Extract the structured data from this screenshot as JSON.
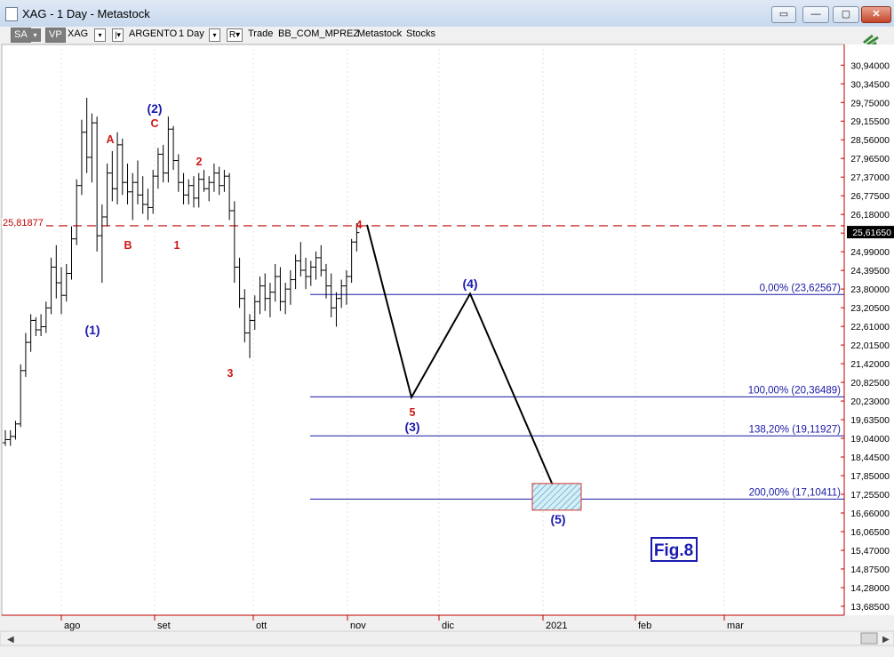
{
  "window": {
    "title": "XAG - 1 Day - Metastock"
  },
  "toolbar": {
    "sa": "SA",
    "vp": "VP",
    "symbol": "XAG",
    "period_toggle": "|▾",
    "name": "ARGENTO",
    "interval": "1 Day",
    "r_button": "R▾",
    "mode": "Trade",
    "source": "BB_COM_MPREZ",
    "app": "Metastock",
    "category": "Stocks"
  },
  "chart_data": {
    "type": "ohlc",
    "price_axis": {
      "ticks": [
        "30,94000",
        "30,34500",
        "29,75000",
        "29,15500",
        "28,56000",
        "27,96500",
        "27,37000",
        "26,77500",
        "26,18000",
        "25,58500",
        "24,99000",
        "24,39500",
        "23,80000",
        "23,20500",
        "22,61000",
        "22,01500",
        "21,42000",
        "20,82500",
        "20,23000",
        "19,63500",
        "19,04000",
        "18,44500",
        "17,85000",
        "17,25500",
        "16,66000",
        "16,06500",
        "15,47000",
        "14,87500",
        "14,28000",
        "13,68500"
      ],
      "ylim": [
        13.4,
        31.6
      ],
      "last_price": "25,61650",
      "last_value": 25.6165
    },
    "time_axis": {
      "labels": [
        "ago",
        "set",
        "ott",
        "nov",
        "dic",
        "2021",
        "feb",
        "mar"
      ]
    },
    "horizontal_line": {
      "label": "25,81877",
      "value": 25.81877,
      "color": "#c00000"
    },
    "fibonacci": [
      {
        "label": "0,00% (23,62567)",
        "value": 23.62567
      },
      {
        "label": "100,00% (20,36489)",
        "value": 20.36489
      },
      {
        "label": "138,20% (19,11927)",
        "value": 19.11927
      },
      {
        "label": "200,00% (17,10411)",
        "value": 17.10411
      }
    ],
    "wave_labels_red": [
      "A",
      "C",
      "2",
      "B",
      "1",
      "3",
      "4",
      "5"
    ],
    "wave_labels_blue": [
      "(1)",
      "(2)",
      "(3)",
      "(4)",
      "(5)"
    ],
    "projection": [
      25.85,
      20.35,
      23.65,
      17.15
    ],
    "target_box": {
      "low": 16.75,
      "high": 17.6
    },
    "fig_label": "Fig.8",
    "bars": [
      [
        18.9,
        19.3,
        18.8,
        19.0
      ],
      [
        19.0,
        19.3,
        18.8,
        19.1
      ],
      [
        19.1,
        19.6,
        19.0,
        19.5
      ],
      [
        19.5,
        21.4,
        19.4,
        21.2
      ],
      [
        21.2,
        22.4,
        21.0,
        22.1
      ],
      [
        22.1,
        23.0,
        21.8,
        22.8
      ],
      [
        22.8,
        22.9,
        22.3,
        22.5
      ],
      [
        22.5,
        23.0,
        22.3,
        22.6
      ],
      [
        22.6,
        23.4,
        22.4,
        23.2
      ],
      [
        23.2,
        24.8,
        23.0,
        24.5
      ],
      [
        24.5,
        25.2,
        23.5,
        24.0
      ],
      [
        24.0,
        24.5,
        23.0,
        23.6
      ],
      [
        23.6,
        24.6,
        23.4,
        24.3
      ],
      [
        24.3,
        25.8,
        24.1,
        25.4
      ],
      [
        25.4,
        27.3,
        25.2,
        27.1
      ],
      [
        27.1,
        29.2,
        26.8,
        28.8
      ],
      [
        28.8,
        29.9,
        27.5,
        28.0
      ],
      [
        28.0,
        29.4,
        27.2,
        29.1
      ],
      [
        29.1,
        29.3,
        25.0,
        25.5
      ],
      [
        25.5,
        26.5,
        24.0,
        26.1
      ],
      [
        26.1,
        27.8,
        25.8,
        27.5
      ],
      [
        27.5,
        28.2,
        26.6,
        27.0
      ],
      [
        27.0,
        28.8,
        26.5,
        28.4
      ],
      [
        28.4,
        28.6,
        26.8,
        27.2
      ],
      [
        27.2,
        27.8,
        26.5,
        26.9
      ],
      [
        26.9,
        27.5,
        26.0,
        27.2
      ],
      [
        27.2,
        27.9,
        26.5,
        26.8
      ],
      [
        26.8,
        27.4,
        26.2,
        26.5
      ],
      [
        26.5,
        27.0,
        26.0,
        26.4
      ],
      [
        26.4,
        27.6,
        26.2,
        27.4
      ],
      [
        27.4,
        28.3,
        27.0,
        28.1
      ],
      [
        28.1,
        28.4,
        27.2,
        27.5
      ],
      [
        27.5,
        29.3,
        27.2,
        28.9
      ],
      [
        28.9,
        29.0,
        27.6,
        27.9
      ],
      [
        27.9,
        28.1,
        26.9,
        27.2
      ],
      [
        27.2,
        27.5,
        26.5,
        26.8
      ],
      [
        26.8,
        27.3,
        26.5,
        27.1
      ],
      [
        27.1,
        27.4,
        26.4,
        26.7
      ],
      [
        26.7,
        27.5,
        26.4,
        27.3
      ],
      [
        27.3,
        27.6,
        26.9,
        27.0
      ],
      [
        27.0,
        27.4,
        26.6,
        27.2
      ],
      [
        27.2,
        27.8,
        26.9,
        27.5
      ],
      [
        27.5,
        27.7,
        26.8,
        27.1
      ],
      [
        27.1,
        27.6,
        26.9,
        27.4
      ],
      [
        27.4,
        27.5,
        26.0,
        26.3
      ],
      [
        26.3,
        26.6,
        24.0,
        24.5
      ],
      [
        24.5,
        24.8,
        23.2,
        23.5
      ],
      [
        23.5,
        23.8,
        22.1,
        22.4
      ],
      [
        22.4,
        23.0,
        21.6,
        22.8
      ],
      [
        22.8,
        23.6,
        22.5,
        23.4
      ],
      [
        23.4,
        24.2,
        23.0,
        23.9
      ],
      [
        23.9,
        24.3,
        23.1,
        23.5
      ],
      [
        23.5,
        24.0,
        22.9,
        23.7
      ],
      [
        23.7,
        24.6,
        23.4,
        24.2
      ],
      [
        24.2,
        24.5,
        23.1,
        23.4
      ],
      [
        23.4,
        24.0,
        23.0,
        23.8
      ],
      [
        23.8,
        24.4,
        23.3,
        24.1
      ],
      [
        24.1,
        24.9,
        23.8,
        24.7
      ],
      [
        24.7,
        25.3,
        24.2,
        24.4
      ],
      [
        24.4,
        24.8,
        23.8,
        24.2
      ],
      [
        24.2,
        24.7,
        23.9,
        24.5
      ],
      [
        24.5,
        25.0,
        24.1,
        24.8
      ],
      [
        24.8,
        25.2,
        24.2,
        24.4
      ],
      [
        24.4,
        24.6,
        23.5,
        23.9
      ],
      [
        23.9,
        24.3,
        22.9,
        23.2
      ],
      [
        23.2,
        23.7,
        22.6,
        23.5
      ],
      [
        23.5,
        24.1,
        23.2,
        23.9
      ],
      [
        23.9,
        24.4,
        23.3,
        24.2
      ],
      [
        24.2,
        25.4,
        24.0,
        25.3
      ],
      [
        25.3,
        25.9,
        25.0,
        25.6
      ]
    ]
  }
}
